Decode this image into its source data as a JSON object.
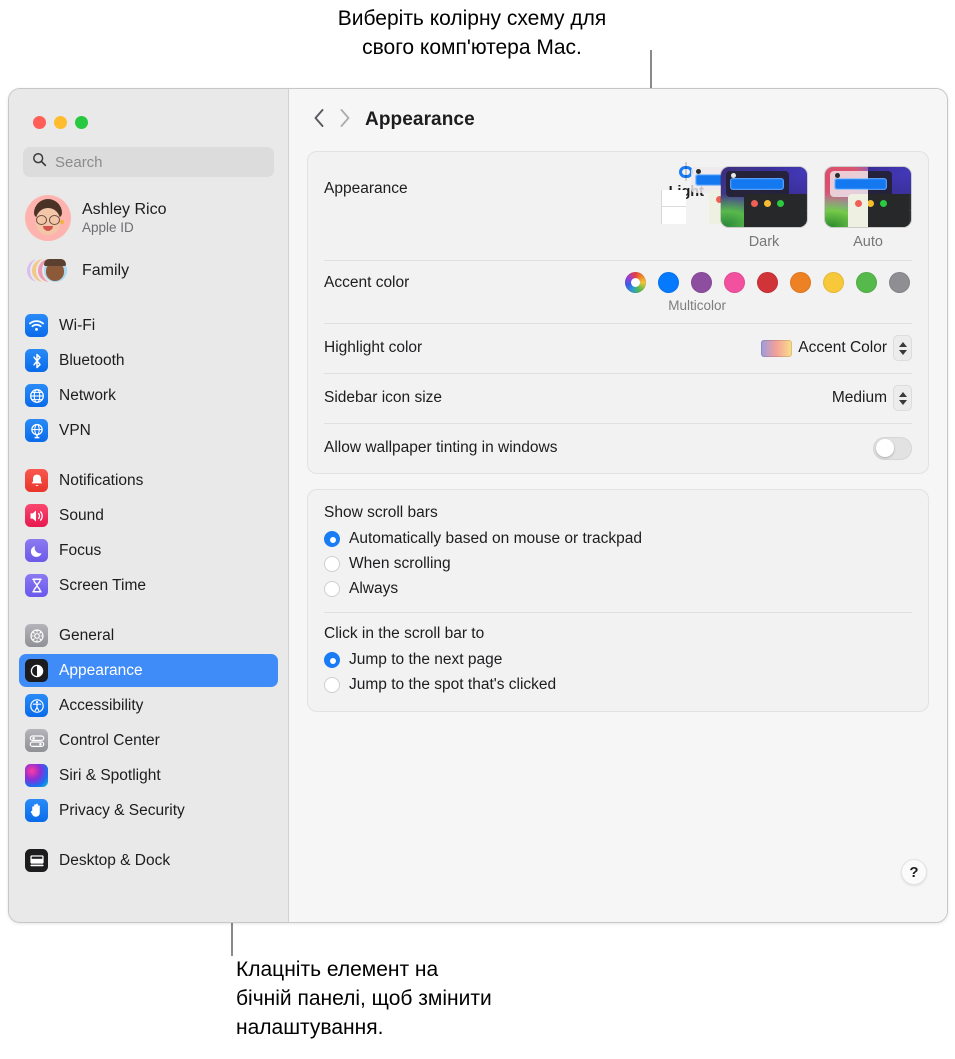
{
  "callouts": {
    "top": "Виберіть колірну схему для\nсвого комп'ютера Mac.",
    "bottom": "Клацніть елемент на\nбічній панелі, щоб змінити\nналаштування."
  },
  "window": {
    "traffic_lights": [
      "close",
      "minimize",
      "zoom"
    ]
  },
  "sidebar": {
    "search": {
      "placeholder": "Search",
      "icon": "search-icon"
    },
    "profile": {
      "name": "Ashley Rico",
      "subtitle": "Apple ID",
      "icon": "avatar"
    },
    "family": {
      "label": "Family",
      "icon": "family-avatars"
    },
    "groups": [
      {
        "items": [
          {
            "label": "Wi-Fi",
            "icon": "wifi-icon"
          },
          {
            "label": "Bluetooth",
            "icon": "bluetooth-icon"
          },
          {
            "label": "Network",
            "icon": "network-icon"
          },
          {
            "label": "VPN",
            "icon": "vpn-icon"
          }
        ]
      },
      {
        "items": [
          {
            "label": "Notifications",
            "icon": "bell-icon"
          },
          {
            "label": "Sound",
            "icon": "speaker-icon"
          },
          {
            "label": "Focus",
            "icon": "moon-icon"
          },
          {
            "label": "Screen Time",
            "icon": "hourglass-icon"
          }
        ]
      },
      {
        "items": [
          {
            "label": "General",
            "icon": "gear-icon"
          },
          {
            "label": "Appearance",
            "icon": "appearance-icon",
            "selected": true
          },
          {
            "label": "Accessibility",
            "icon": "accessibility-icon"
          },
          {
            "label": "Control Center",
            "icon": "control-center-icon"
          },
          {
            "label": "Siri & Spotlight",
            "icon": "siri-icon"
          },
          {
            "label": "Privacy & Security",
            "icon": "hand-icon"
          }
        ]
      },
      {
        "items": [
          {
            "label": "Desktop & Dock",
            "icon": "desktop-dock-icon"
          }
        ]
      }
    ]
  },
  "detail": {
    "toolbar": {
      "back_icon": "chevron-left-icon",
      "forward_icon": "chevron-right-icon",
      "title": "Appearance"
    },
    "appearance_row": {
      "label": "Appearance",
      "options": [
        {
          "caption": "Light",
          "selected": true
        },
        {
          "caption": "Dark",
          "selected": false
        },
        {
          "caption": "Auto",
          "selected": false
        }
      ]
    },
    "accent_row": {
      "label": "Accent color",
      "caption": "Multicolor",
      "swatches": [
        {
          "name": "multicolor",
          "color": "multicolor",
          "selected": true
        },
        {
          "name": "blue",
          "color": "#057aff"
        },
        {
          "name": "purple",
          "color": "#8e4ea0"
        },
        {
          "name": "pink",
          "color": "#f2519f"
        },
        {
          "name": "red",
          "color": "#d03438"
        },
        {
          "name": "orange",
          "color": "#ee8124"
        },
        {
          "name": "yellow",
          "color": "#f7c83a"
        },
        {
          "name": "green",
          "color": "#56b94b"
        },
        {
          "name": "graphite",
          "color": "#8e8e93"
        }
      ]
    },
    "highlight_row": {
      "label": "Highlight color",
      "value": "Accent Color",
      "swatch_gradient": "#9a9ce0 → #f2a09a → #fae08a"
    },
    "sidebar_icon_row": {
      "label": "Sidebar icon size",
      "value": "Medium"
    },
    "tinting_row": {
      "label": "Allow wallpaper tinting in windows",
      "toggle_on": false
    },
    "scrollbars": {
      "title": "Show scroll bars",
      "options": [
        {
          "label": "Automatically based on mouse or trackpad",
          "selected": true
        },
        {
          "label": "When scrolling",
          "selected": false
        },
        {
          "label": "Always",
          "selected": false
        }
      ]
    },
    "click_scrollbar": {
      "title": "Click in the scroll bar to",
      "options": [
        {
          "label": "Jump to the next page",
          "selected": true
        },
        {
          "label": "Jump to the spot that's clicked",
          "selected": false
        }
      ]
    },
    "help_button": {
      "label": "?",
      "icon": "help-icon"
    }
  },
  "colors": {
    "accent": "#1a7cf5",
    "sidebar_bg": "#e9e9e9",
    "detail_bg": "#f6f6f6",
    "group_bg": "#f2f2f2",
    "selection": "#3f8cf8"
  }
}
